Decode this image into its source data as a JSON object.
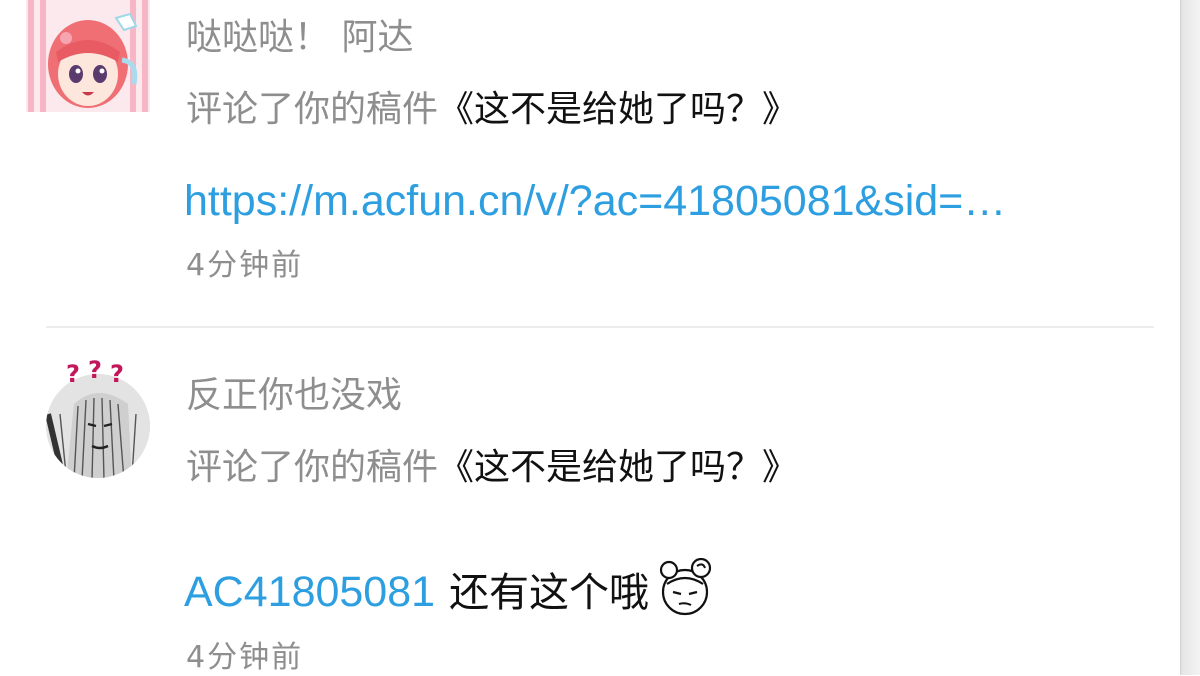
{
  "notifications": [
    {
      "user_name": "哒哒哒！ 阿达",
      "action_prefix": "评论了你的稿件",
      "work_title": "《这不是给她了吗？》",
      "content_link": "https://m.acfun.cn/v/?ac=41805081&sid=…",
      "time": "4分钟前",
      "avatar_icon": "anime-girl-avatar"
    },
    {
      "user_name": "反正你也没戏",
      "action_prefix": "评论了你的稿件",
      "work_title": "《这不是给她了吗？》",
      "content_link": "AC41805081",
      "content_text": "还有这个哦",
      "emoji_icon": "smug-face-sticker",
      "time": "4分钟前",
      "avatar_icon": "question-marks-manga-avatar"
    }
  ],
  "colors": {
    "link": "#2d9fe0",
    "meta_text": "#8e8e8e",
    "body_text": "#111111",
    "divider": "#ececec"
  }
}
